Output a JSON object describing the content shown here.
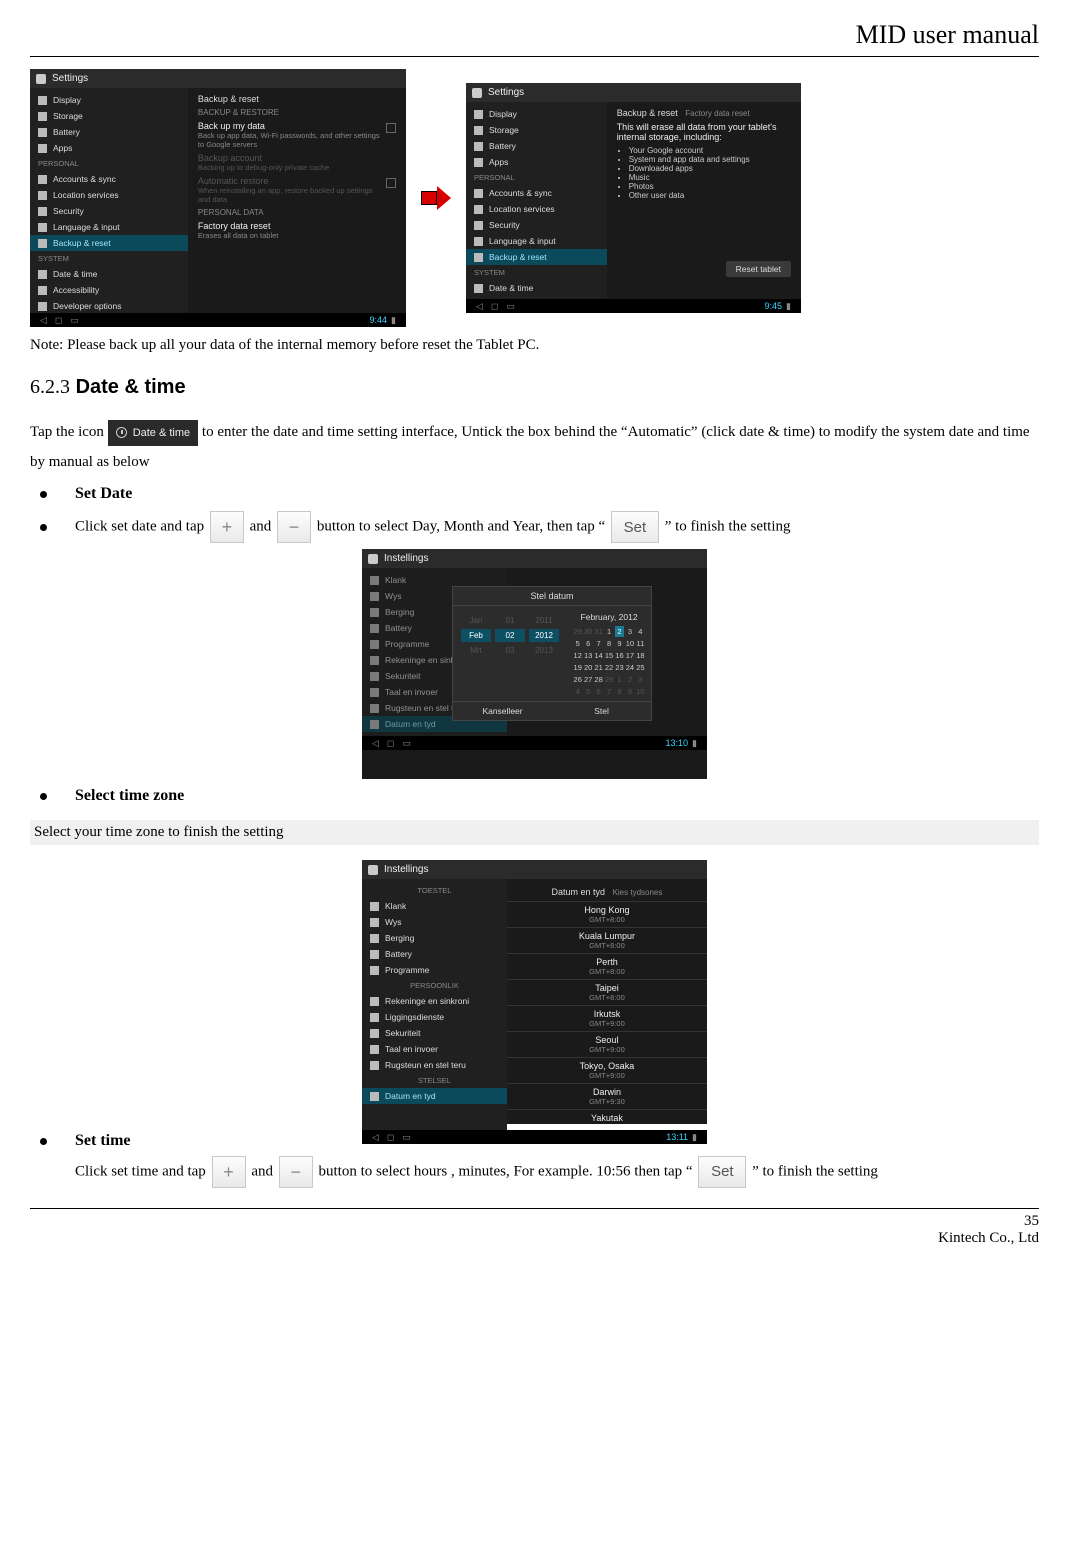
{
  "doc_title": "MID user manual",
  "footer_company": "Kintech Co., Ltd",
  "page_number": "35",
  "note": "Note: Please back up all your data of the internal memory before reset the Tablet PC.",
  "section": {
    "num": "6.2.3",
    "title": "Date & time"
  },
  "chip_label": "Date & time",
  "para1_a": "Tap the icon ",
  "para1_b": " to enter the date and time setting interface, Untick the box behind the “Automatic” (click date & time) to modify the system date and time by manual as below",
  "set_date_h": "Set Date",
  "set_date_line_a": "Click set date and tap ",
  "set_date_line_b": " and ",
  "set_date_line_c": " button to select Day, Month and Year, then tap “",
  "set_date_line_d": "” to finish the setting",
  "select_tz_h": "Select time zone",
  "select_tz_text": "Select your time zone to finish the setting",
  "set_time_h": "Set time",
  "set_time_line_a": "Click set time and tap ",
  "set_time_line_b": " and ",
  "set_time_line_c": " button to select hours , minutes, For example. 10:56 then tap “",
  "set_time_line_d": "” to finish the setting",
  "set_label": "Set",
  "android": {
    "settings": "Settings",
    "side_sections": {
      "personal": "PERSONAL",
      "system": "SYSTEM",
      "device": "TOESTEL",
      "personal2": "PERSOONLIK",
      "system2": "STELSEL"
    },
    "side": {
      "display": "Display",
      "storage": "Storage",
      "battery": "Battery",
      "apps": "Apps",
      "accounts": "Accounts & sync",
      "location": "Location services",
      "security": "Security",
      "lang": "Language & input",
      "backup": "Backup & reset",
      "datetime": "Date & time",
      "accessibility": "Accessibility",
      "developer": "Developer options"
    },
    "backup_pane": {
      "head": "Backup & reset",
      "sec1": "BACKUP & RESTORE",
      "r1": "Back up my data",
      "r1d": "Back up app data, Wi-Fi passwords, and other settings to Google servers",
      "r2": "Backup account",
      "r2d": "Backing up to debug-only private cache",
      "r3": "Automatic restore",
      "r3d": "When reinstalling an app, restore backed up settings and data",
      "sec2": "PERSONAL DATA",
      "r4": "Factory data reset",
      "r4d": "Erases all data on tablet"
    },
    "reset_pane": {
      "head": "Backup & reset",
      "sub": "Factory data reset",
      "msg": "This will erase all data from your tablet's internal storage, including:",
      "b1": "Your Google account",
      "b2": "System and app data and settings",
      "b3": "Downloaded apps",
      "b4": "Music",
      "b5": "Photos",
      "b6": "Other user data",
      "btn": "Reset tablet"
    },
    "time": {
      "a": "9:44",
      "b": "9:45",
      "c": "13:10",
      "d": "13:11"
    },
    "dateset": {
      "title": "Stel datum",
      "month_label": "February, 2012",
      "spin": {
        "m": "Feb",
        "d": "02",
        "y": "2012"
      },
      "cancel": "Kanselleer",
      "set": "Stel",
      "days": [
        "29",
        "30",
        "31",
        "1",
        "2",
        "3",
        "4",
        "5",
        "6",
        "7",
        "8",
        "9",
        "10",
        "11",
        "12",
        "13",
        "14",
        "15",
        "16",
        "17",
        "18",
        "19",
        "20",
        "21",
        "22",
        "23",
        "24",
        "25",
        "26",
        "27",
        "28",
        "29",
        "1",
        "2",
        "3",
        "4",
        "5",
        "6",
        "7",
        "8",
        "9",
        "10"
      ],
      "side": {
        "klank": "Klank",
        "wys": "Wys",
        "berging": "Berging",
        "battery": "Battery",
        "programme": "Programme",
        "reken": "Rekeninge en sinkroni",
        "ligging": "Liggingsdienste",
        "sekuriteit": "Sekuriteit",
        "taal": "Taal en invoer",
        "rugsteun": "Rugsteun en stel teru",
        "datum": "Datum en tyd"
      }
    },
    "tz": {
      "header": "Datum en tyd",
      "sub": "Kies tydsones",
      "items": [
        {
          "n": "Hong Kong",
          "o": "GMT+8:00"
        },
        {
          "n": "Kuala Lumpur",
          "o": "GMT+8:00"
        },
        {
          "n": "Perth",
          "o": "GMT+8:00"
        },
        {
          "n": "Taipei",
          "o": "GMT+8:00"
        },
        {
          "n": "Irkutsk",
          "o": "GMT+9:00"
        },
        {
          "n": "Seoul",
          "o": "GMT+9:00"
        },
        {
          "n": "Tokyo, Osaka",
          "o": "GMT+9:00"
        },
        {
          "n": "Darwin",
          "o": "GMT+9:30"
        },
        {
          "n": "Yakutak",
          "o": ""
        }
      ]
    }
  }
}
